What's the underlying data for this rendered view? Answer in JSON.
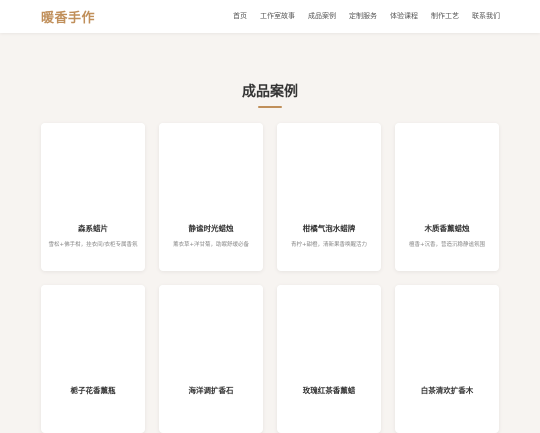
{
  "brand": "暖香手作",
  "nav": [
    {
      "label": "首页"
    },
    {
      "label": "工作室故事"
    },
    {
      "label": "成品案例"
    },
    {
      "label": "定制服务"
    },
    {
      "label": "体验课程"
    },
    {
      "label": "制作工艺"
    },
    {
      "label": "联系我们"
    }
  ],
  "section": {
    "title": "成品案例"
  },
  "cases": [
    {
      "title": "森系蜡片",
      "desc": "雪松+佛手柑，挂衣间/衣柜专属香氛"
    },
    {
      "title": "静谧时光蜡烛",
      "desc": "薰衣草+洋甘菊，助眠舒缓必备"
    },
    {
      "title": "柑橘气泡水蜡牌",
      "desc": "青柠+甜橙，清新果香唤醒活力"
    },
    {
      "title": "木质香薰蜡烛",
      "desc": "檀香+沉香，营造沉稳静谧氛围"
    },
    {
      "title": "栀子花香薰瓶",
      "desc": ""
    },
    {
      "title": "海洋调扩香石",
      "desc": ""
    },
    {
      "title": "玫瑰红茶香薰蜡",
      "desc": ""
    },
    {
      "title": "白茶清欢扩香木",
      "desc": ""
    }
  ],
  "colors": {
    "accent": "#c08f5a",
    "background": "#f7f4f1",
    "card": "#ffffff"
  }
}
